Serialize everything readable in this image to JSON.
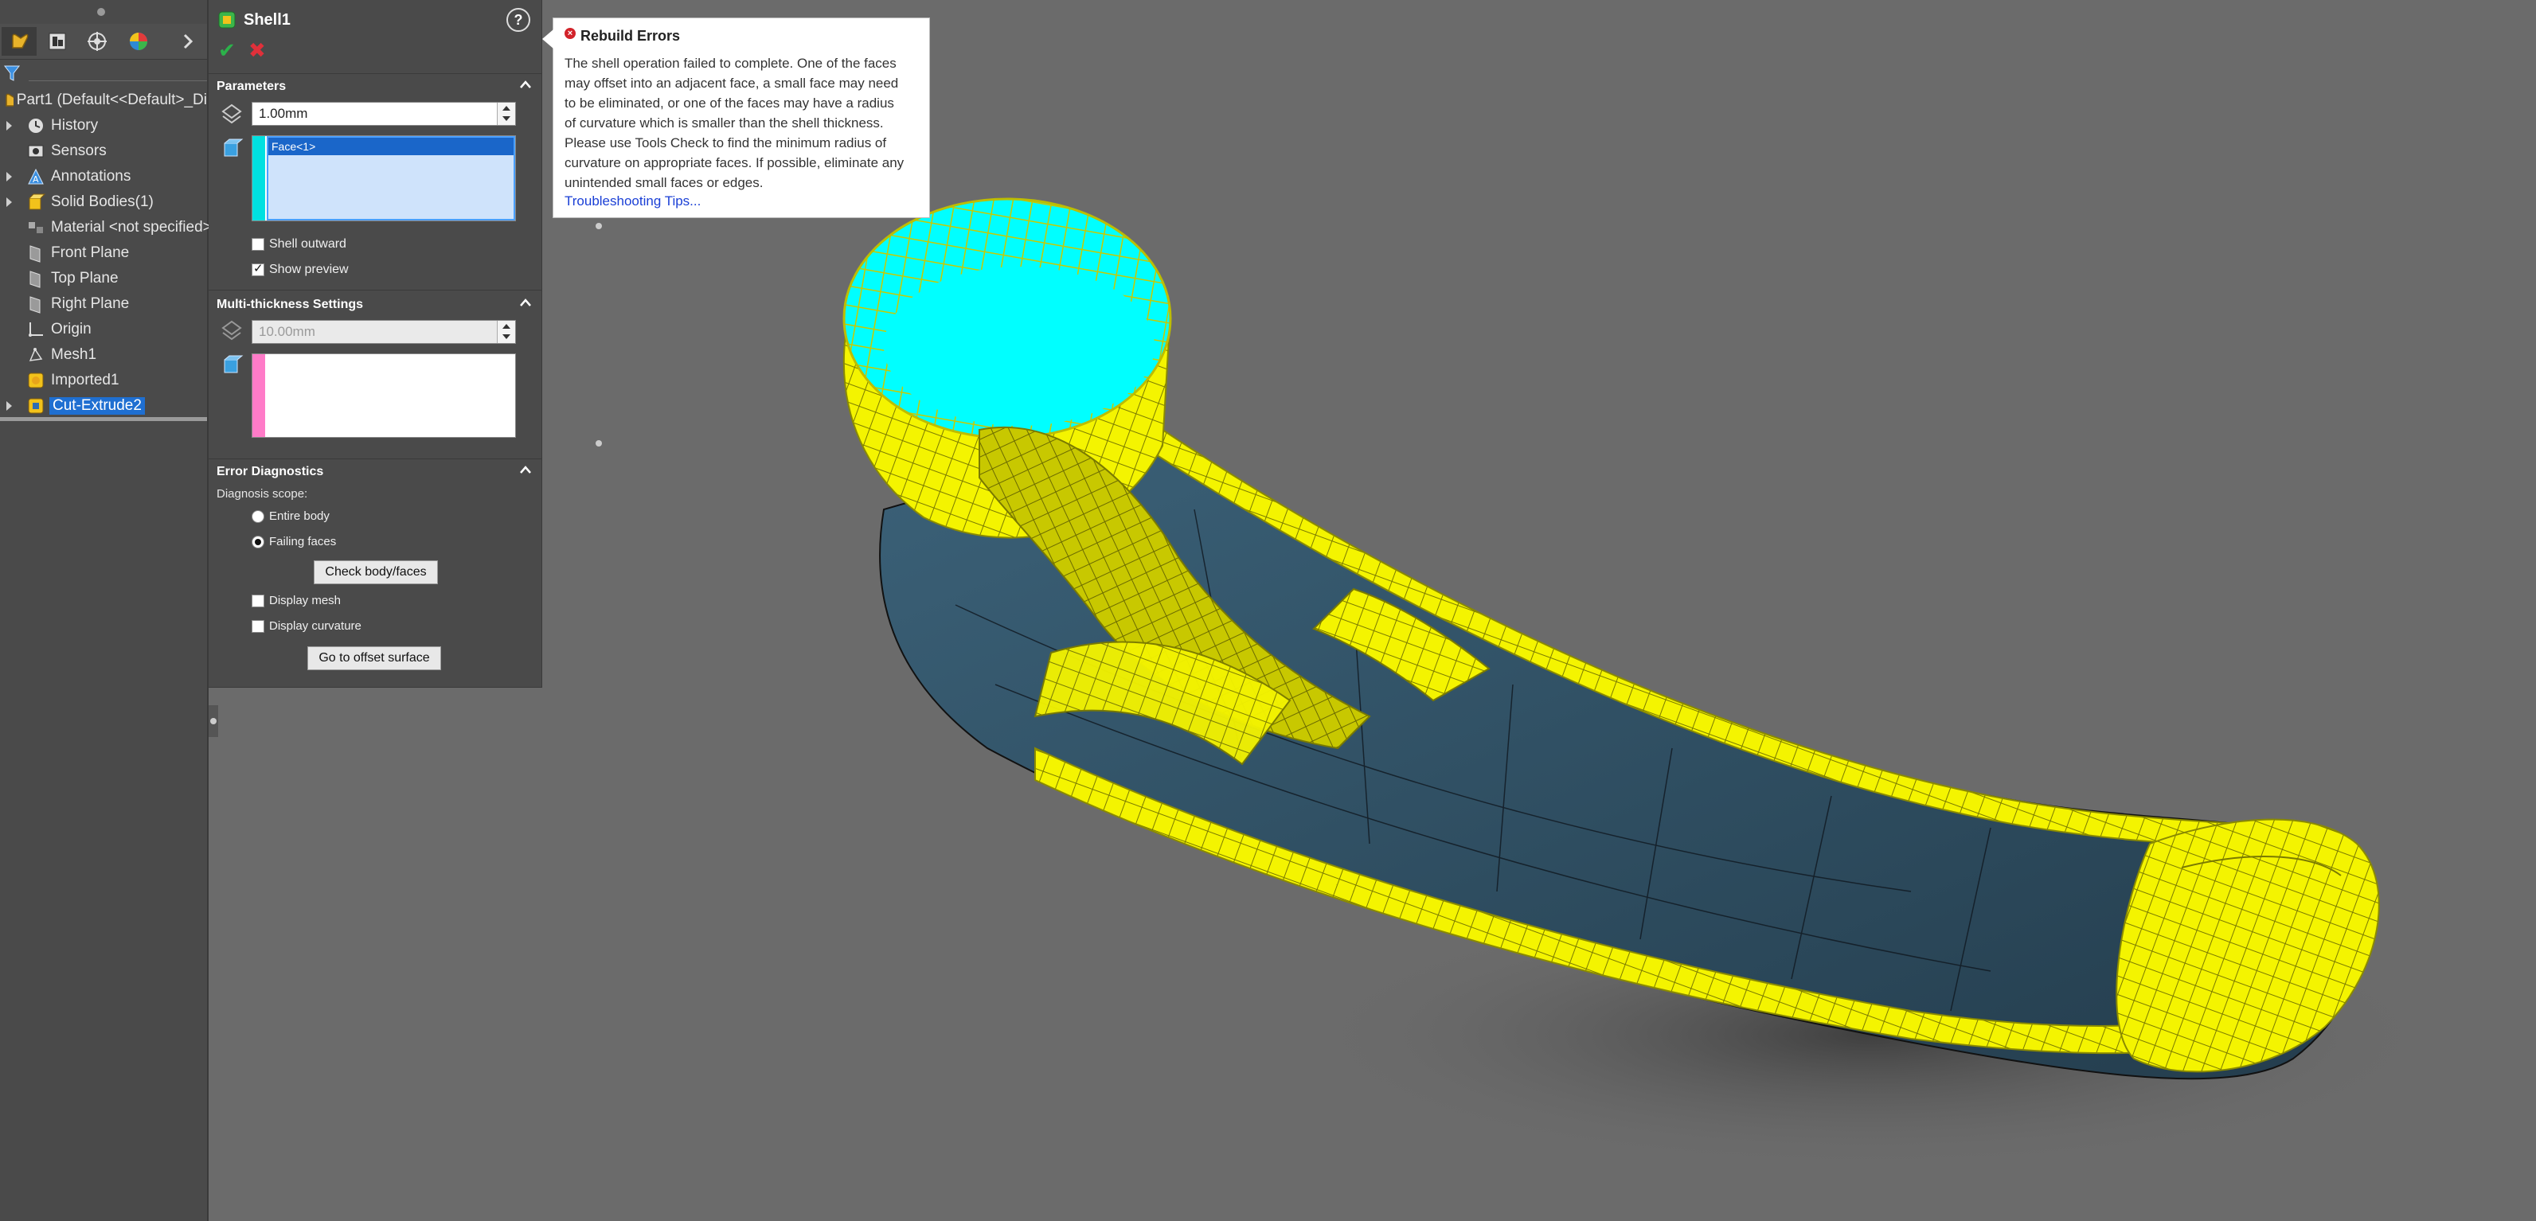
{
  "feature_tree": {
    "root_label": "Part1  (Default<<Default>_Di",
    "items": [
      {
        "label": "History",
        "icon": "history-icon",
        "expandable": true,
        "selected": false
      },
      {
        "label": "Sensors",
        "icon": "sensors-icon",
        "expandable": false,
        "selected": false
      },
      {
        "label": "Annotations",
        "icon": "annotations-icon",
        "expandable": true,
        "selected": false
      },
      {
        "label": "Solid Bodies(1)",
        "icon": "solid-bodies-icon",
        "expandable": true,
        "selected": false
      },
      {
        "label": "Material <not specified>",
        "icon": "material-icon",
        "expandable": false,
        "selected": false
      },
      {
        "label": "Front Plane",
        "icon": "plane-icon",
        "expandable": false,
        "selected": false
      },
      {
        "label": "Top Plane",
        "icon": "plane-icon",
        "expandable": false,
        "selected": false
      },
      {
        "label": "Right Plane",
        "icon": "plane-icon",
        "expandable": false,
        "selected": false
      },
      {
        "label": "Origin",
        "icon": "origin-icon",
        "expandable": false,
        "selected": false
      },
      {
        "label": "Mesh1",
        "icon": "mesh-icon",
        "expandable": false,
        "selected": false
      },
      {
        "label": "Imported1",
        "icon": "imported-icon",
        "expandable": false,
        "selected": false
      },
      {
        "label": "Cut-Extrude2",
        "icon": "cut-extrude-icon",
        "expandable": true,
        "selected": true
      }
    ]
  },
  "property_manager": {
    "title": "Shell1",
    "parameters": {
      "section_title": "Parameters",
      "thickness_value": "1.00mm",
      "faces_to_remove": [
        "Face<1>"
      ],
      "shell_outward_label": "Shell outward",
      "shell_outward_checked": false,
      "show_preview_label": "Show preview",
      "show_preview_checked": true
    },
    "multi_thickness": {
      "section_title": "Multi-thickness Settings",
      "thickness_value": "10.00mm"
    },
    "error_diagnostics": {
      "section_title": "Error Diagnostics",
      "scope_label": "Diagnosis scope:",
      "entire_body_label": "Entire body",
      "failing_faces_label": "Failing faces",
      "selected_scope": "Failing faces",
      "check_button_label": "Check body/faces",
      "display_mesh_label": "Display mesh",
      "display_curvature_label": "Display curvature",
      "offset_button_label": "Go to offset surface"
    }
  },
  "rebuild_errors": {
    "title": "Rebuild Errors",
    "lines": [
      "The shell operation failed to complete. One of the faces",
      "may offset into an adjacent face, a small face may need",
      "to be eliminated, or one of the faces may have a radius",
      "of curvature which is smaller than the shell thickness.",
      "Please use Tools Check to find the minimum radius of",
      "curvature on appropriate faces. If possible, eliminate any",
      "unintended small faces or edges."
    ],
    "link_text": "Troubleshooting Tips..."
  },
  "colors": {
    "viewport_bg": "#6b6b6b",
    "body_fill": "#2e4d61",
    "failing_face_highlight": "#f2f200",
    "selected_face": "#00ffff",
    "selection_blue": "#1f6fd1"
  }
}
